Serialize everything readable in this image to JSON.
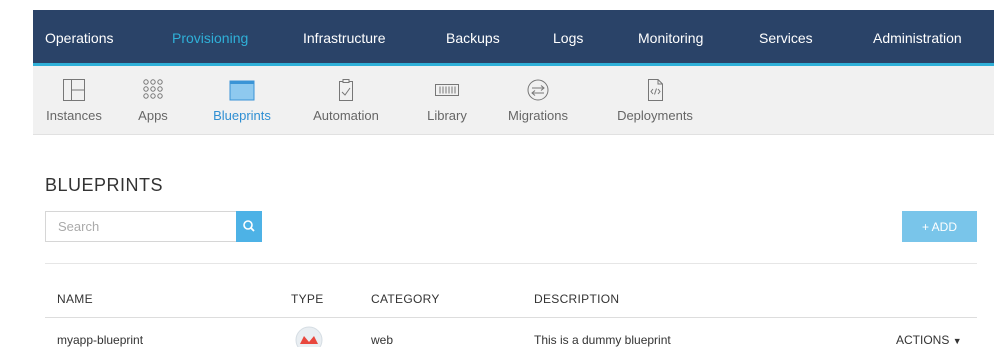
{
  "topnav": {
    "items": [
      {
        "label": "Operations",
        "active": false
      },
      {
        "label": "Provisioning",
        "active": true
      },
      {
        "label": "Infrastructure",
        "active": false
      },
      {
        "label": "Backups",
        "active": false
      },
      {
        "label": "Logs",
        "active": false
      },
      {
        "label": "Monitoring",
        "active": false
      },
      {
        "label": "Services",
        "active": false
      },
      {
        "label": "Administration",
        "active": false
      }
    ],
    "colors": {
      "background": "#2a4368",
      "accent": "#2fb0d8"
    }
  },
  "subnav": {
    "items": [
      {
        "label": "Instances",
        "icon": "instances-icon"
      },
      {
        "label": "Apps",
        "icon": "apps-icon"
      },
      {
        "label": "Blueprints",
        "icon": "blueprints-icon",
        "active": true
      },
      {
        "label": "Automation",
        "icon": "automation-icon"
      },
      {
        "label": "Library",
        "icon": "library-icon"
      },
      {
        "label": "Migrations",
        "icon": "migrations-icon"
      },
      {
        "label": "Deployments",
        "icon": "deployments-icon"
      }
    ]
  },
  "page": {
    "title": "BLUEPRINTS"
  },
  "search": {
    "placeholder": "Search",
    "value": ""
  },
  "add_button": {
    "label": "+ ADD"
  },
  "table": {
    "headers": {
      "name": "NAME",
      "type": "TYPE",
      "category": "CATEGORY",
      "description": "DESCRIPTION"
    },
    "rows": [
      {
        "name": "myapp-blueprint",
        "type_icon": "blueprint-type-icon",
        "category": "web",
        "description": "This is a dummy blueprint",
        "actions": "ACTIONS"
      }
    ]
  }
}
